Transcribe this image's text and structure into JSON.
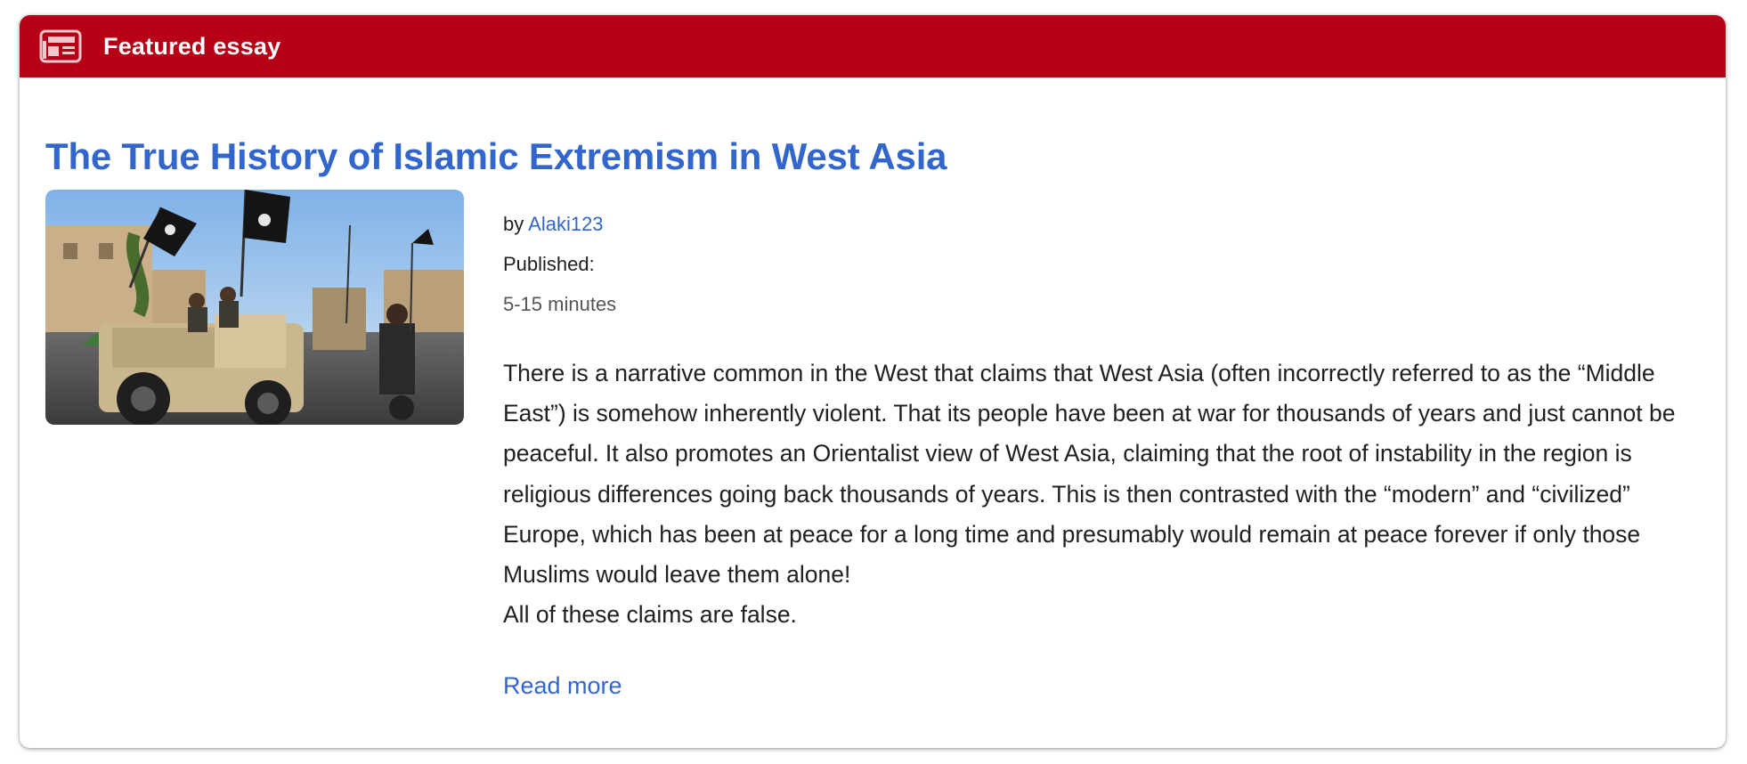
{
  "colors": {
    "header_bg": "#b70015",
    "link": "#3366cc",
    "text": "#202020",
    "muted": "#555555"
  },
  "header": {
    "icon": "newspaper-icon",
    "title": "Featured essay"
  },
  "article": {
    "title": "The True History of Islamic Extremism in West Asia",
    "image_icon": "photo-thumbnail",
    "by_label": "by",
    "author": "Alaki123",
    "published_label": "Published:",
    "reading_time": "5-15 minutes",
    "excerpt": "There is a narrative common in the West that claims that West Asia (often incorrectly referred to as the “Middle East”) is somehow inherently violent. That its people have been at war for thousands of years and just cannot be peaceful. It also promotes an Orientalist view of West Asia, claiming that the root of instability in the region is religious differences going back thousands of years. This is then contrasted with the “modern” and “civilized” Europe, which has been at peace for a long time and presumably would remain at peace forever if only those Muslims would leave them alone!",
    "conclusion": "All of these claims are false.",
    "read_more": "Read more"
  }
}
